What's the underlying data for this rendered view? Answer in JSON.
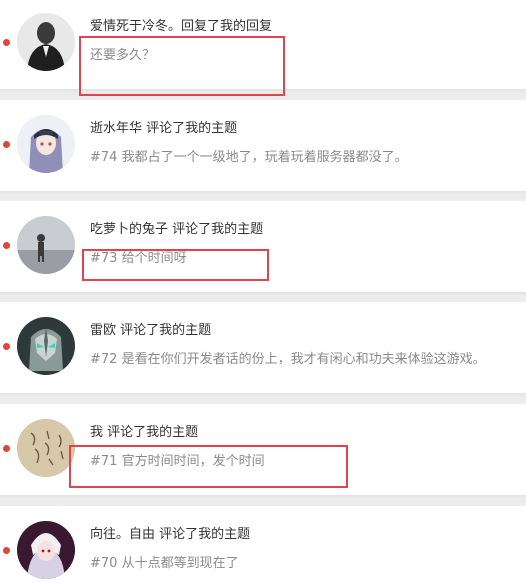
{
  "notifications": [
    {
      "user": "爱情死于冷冬",
      "action": "回复了我的回复",
      "separator": "。",
      "content": "还要多久？",
      "avatar_icon": "avatar-suit-man-photo"
    },
    {
      "user": "逝水年华",
      "action": "评论了我的主题",
      "separator": " ",
      "content": "#74 我都占了一个一级地了，玩着玩着服务器都没了。",
      "avatar_icon": "avatar-anime-girl"
    },
    {
      "user": "吃萝卜的兔子",
      "action": "评论了我的主题",
      "separator": " ",
      "content": "#73 给个时间呀",
      "avatar_icon": "avatar-silhouette-landscape"
    },
    {
      "user": "雷欧",
      "action": "评论了我的主题",
      "separator": " ",
      "content": "#72 是看在你们开发者话的份上，我才有闲心和功夫来体验这游戏。",
      "avatar_icon": "avatar-armored-helmet"
    },
    {
      "user": "我",
      "action": "评论了我的主题",
      "separator": " ",
      "content": "#71 官方时间时间，发个时间",
      "avatar_icon": "avatar-handwritten-paper"
    },
    {
      "user": "向往。自由",
      "action": "评论了我的主题",
      "separator": " ",
      "content": "#70 从十点都等到现在了",
      "avatar_icon": "avatar-white-hair-anime"
    }
  ],
  "colors": {
    "unread_dot": "#e0453a",
    "highlight_box": "#e0454d",
    "card_bg": "#ffffff",
    "page_bg": "#ececec"
  }
}
